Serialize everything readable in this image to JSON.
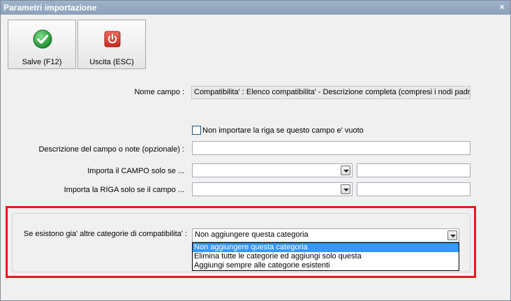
{
  "window": {
    "title": "Parametri importazione",
    "close_glyph": "×"
  },
  "toolbar": {
    "save": {
      "label": "Salve (F12)",
      "icon": "check-icon"
    },
    "exit": {
      "label": "Uscita (ESC)",
      "icon": "power-icon"
    }
  },
  "form": {
    "field_name_label": "Nome campo :",
    "field_name_value": "Compatibilita' : Elenco compatibilita' - Descrizione completa (compresi i nodi padre)",
    "skip_empty_label": "Non importare la riga se questo campo e' vuoto",
    "skip_empty_checked": false,
    "description_label": "Descrizione del campo o note (opzionale) :",
    "description_value": "",
    "import_field_if_label": "Importa il CAMPO solo se ...",
    "import_field_if_operator": "",
    "import_field_if_value": "",
    "import_row_if_label": "Importa la RIGA solo se il campo ...",
    "import_row_if_operator": "",
    "import_row_if_value": ""
  },
  "categories": {
    "label": "Se esistono gia' altre categorie di compatibilita' :",
    "selected": "Non aggiungere questa categoria",
    "options": [
      "Non aggiungere questa categoria",
      "Elimina tutte le categorie ed aggiungi solo questa",
      "Aggiungi sempre alle categorie esistenti"
    ],
    "highlighted_index": 0
  },
  "colors": {
    "titlebar": "#8ba1ba",
    "highlight_frame": "#e31b1b",
    "selection": "#3399ff",
    "save_icon": "#2ea043",
    "exit_icon": "#d9362b"
  }
}
